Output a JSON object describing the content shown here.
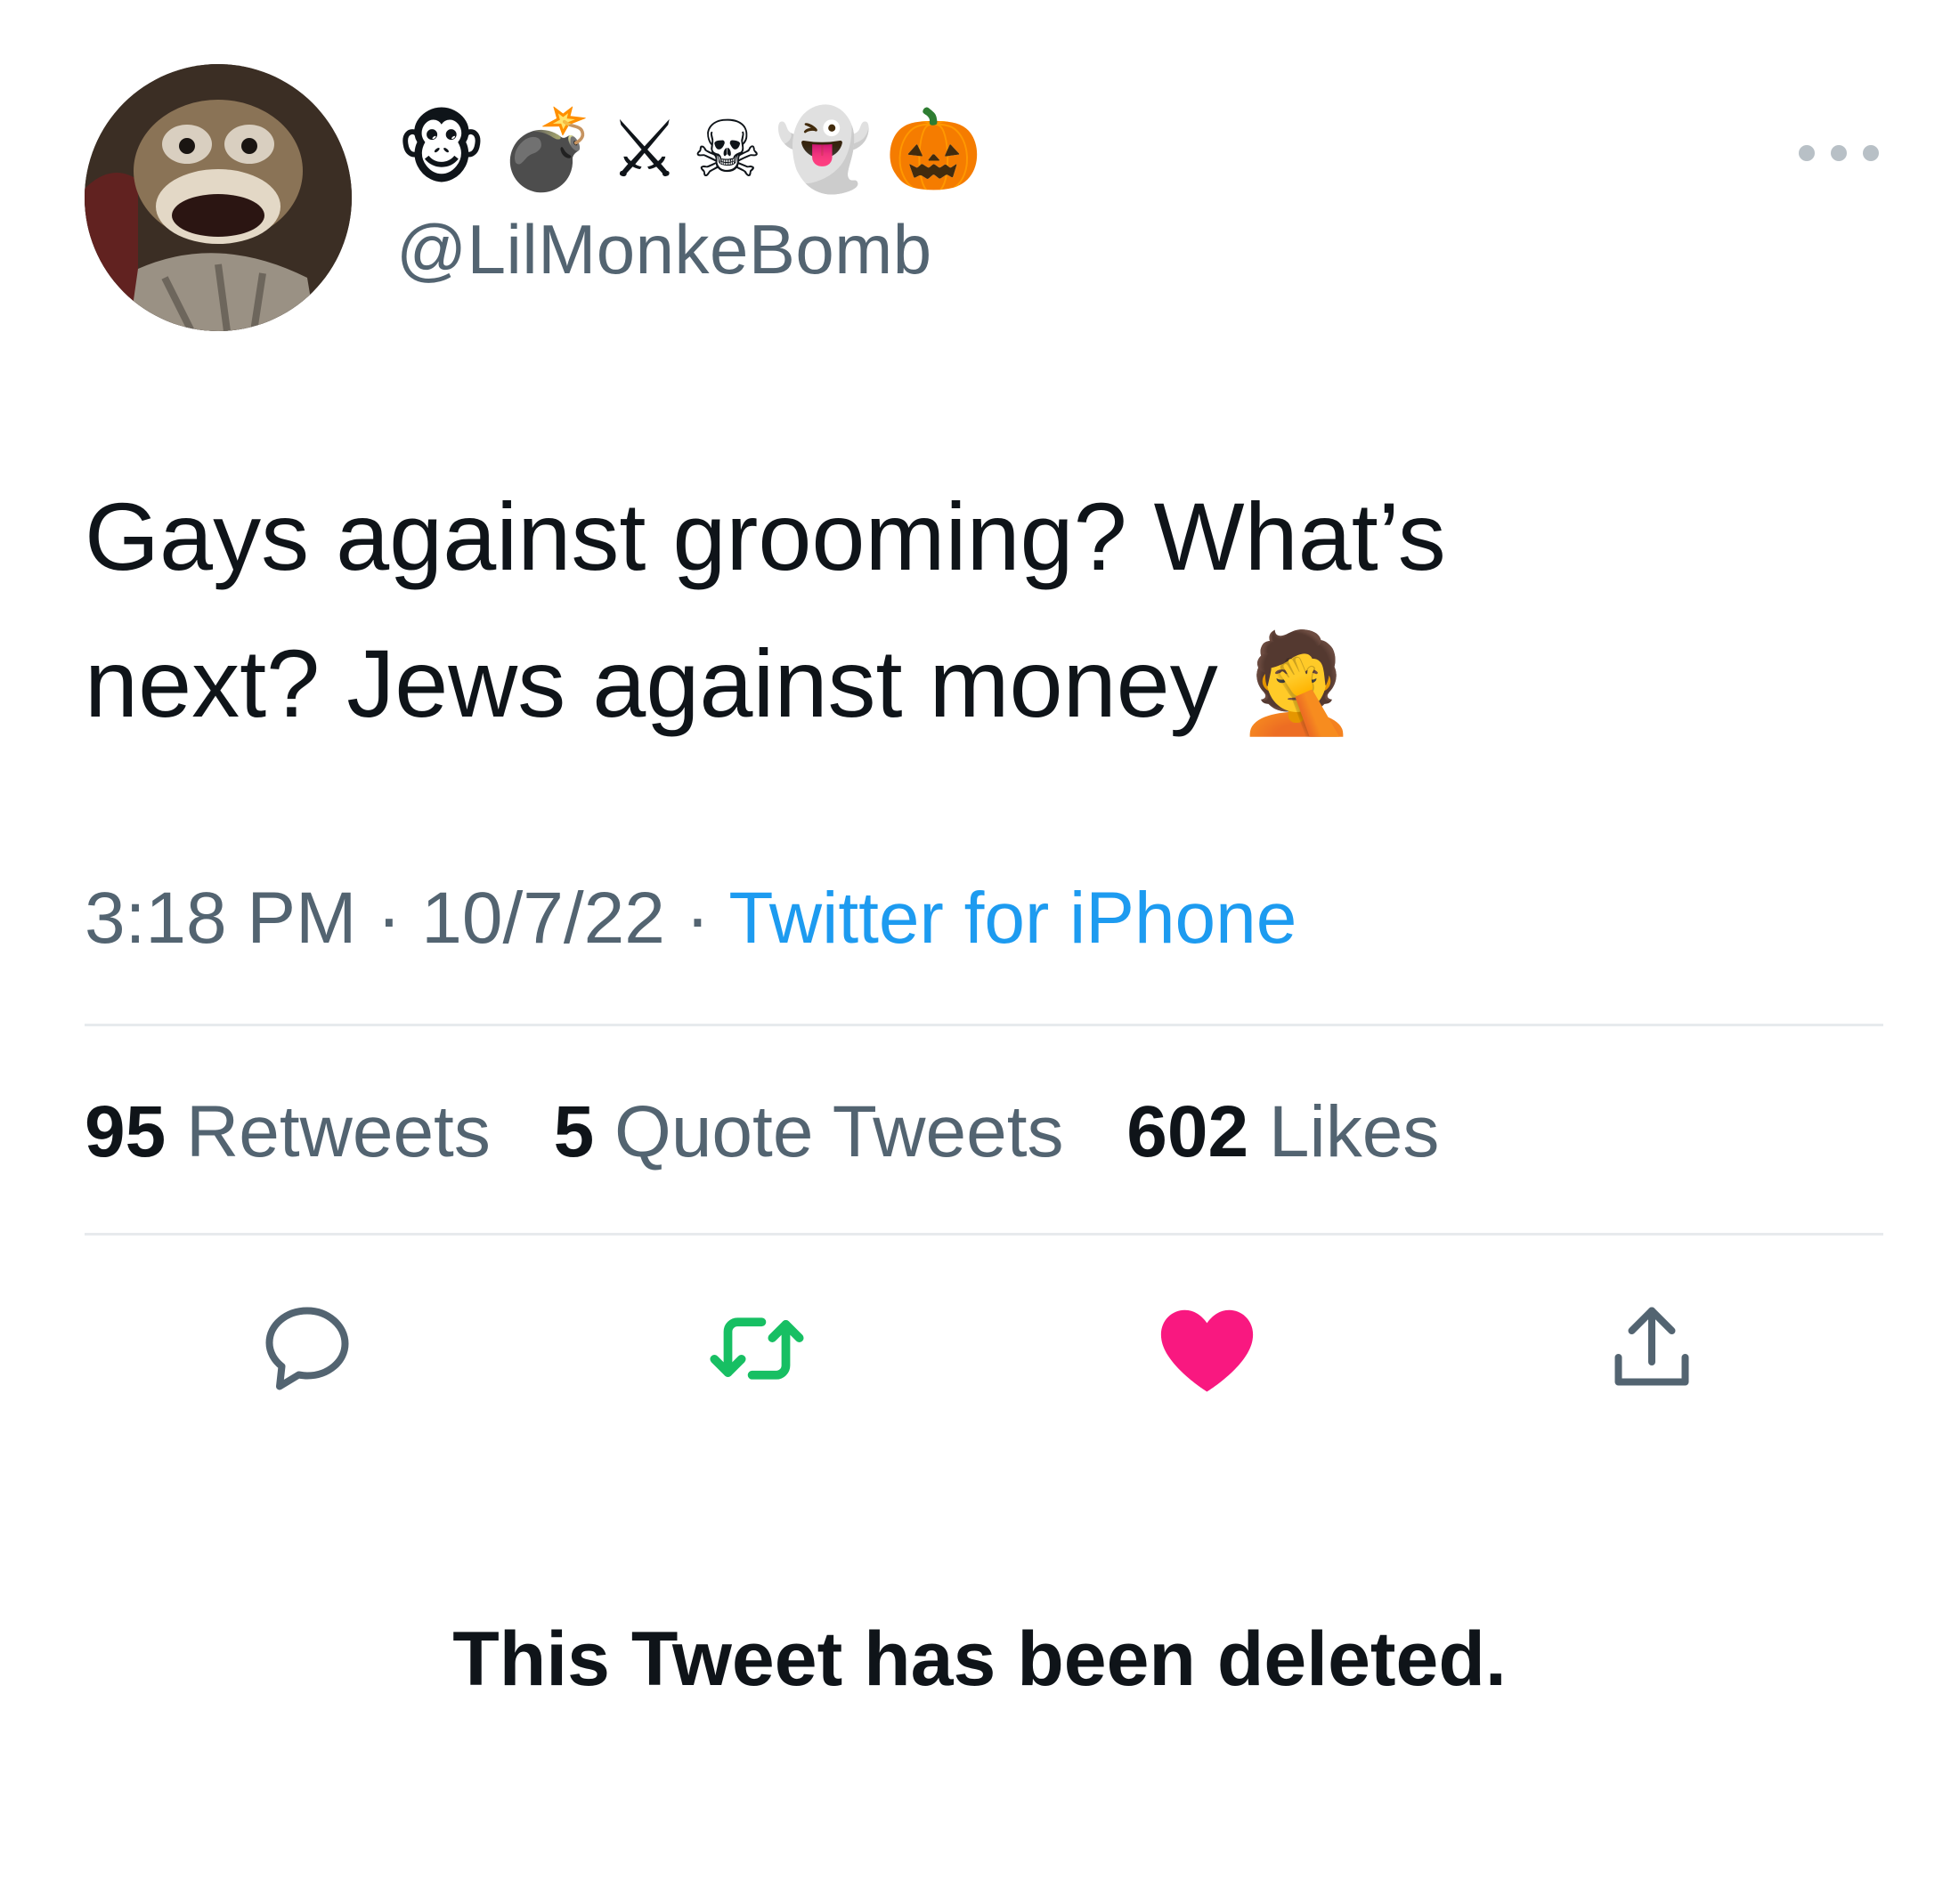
{
  "user": {
    "display_name_emojis": [
      "🐵",
      "💣",
      "⚔",
      "☠",
      "👻",
      "🎃"
    ],
    "handle": "@LilMonkeBomb"
  },
  "tweet": {
    "text_line1": "Gays against grooming? What’s",
    "text_line2": "next? Jews against money",
    "text_emoji": "🤦"
  },
  "meta": {
    "time": "3:18 PM",
    "separator": "·",
    "date": "10/7/22",
    "source": "Twitter for iPhone"
  },
  "stats": {
    "retweets_count": "95",
    "retweets_label": "Retweets",
    "quotes_count": "5",
    "quotes_label": "Quote Tweets",
    "likes_count": "602",
    "likes_label": "Likes"
  },
  "actions": {
    "reply_icon": "reply-icon",
    "retweet_icon": "retweet-icon",
    "like_icon": "heart-icon",
    "share_icon": "share-icon"
  },
  "colors": {
    "retweet": "#17bf63",
    "like": "#f91880",
    "link": "#1d9bf0",
    "muted": "#536471"
  },
  "notice": "This Tweet has been deleted."
}
